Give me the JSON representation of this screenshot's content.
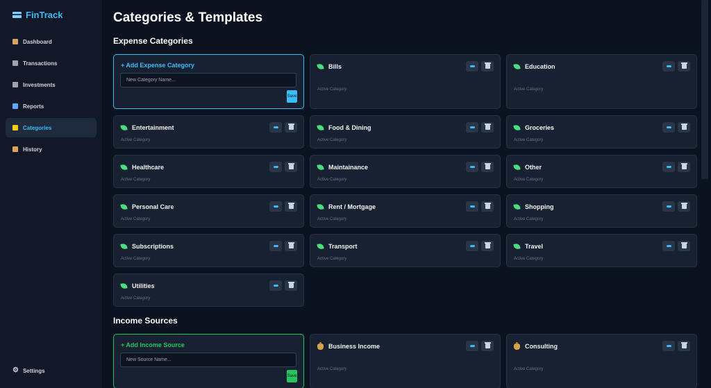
{
  "app": {
    "name": "FinTrack"
  },
  "nav": {
    "items": [
      {
        "label": "Dashboard",
        "icon": "house-icon",
        "color": "#d6a36a"
      },
      {
        "label": "Transactions",
        "icon": "table-icon",
        "color": "#9ca3af"
      },
      {
        "label": "Investments",
        "icon": "chart-line-icon",
        "color": "#9ca3af"
      },
      {
        "label": "Reports",
        "icon": "bar-chart-icon",
        "color": "#60a5fa"
      },
      {
        "label": "Categories",
        "icon": "tag-icon",
        "color": "#facc15",
        "active": true
      },
      {
        "label": "History",
        "icon": "scroll-icon",
        "color": "#e0a458"
      }
    ],
    "settings_label": "Settings"
  },
  "page": {
    "title": "Categories & Templates"
  },
  "expense": {
    "title": "Expense Categories",
    "add_label": "+ Add Expense Category",
    "input_placeholder": "New Category Name...",
    "save_label": "Save",
    "accent": "#38bdf8",
    "categories": [
      {
        "name": "Bills",
        "status": "Active Category"
      },
      {
        "name": "Education",
        "status": "Active Category"
      },
      {
        "name": "Entertainment",
        "status": "Active Category"
      },
      {
        "name": "Food & Dining",
        "status": "Active Category"
      },
      {
        "name": "Groceries",
        "status": "Active Category"
      },
      {
        "name": "Healthcare",
        "status": "Active Category"
      },
      {
        "name": "Maintainance",
        "status": "Active Category"
      },
      {
        "name": "Other",
        "status": "Active Category"
      },
      {
        "name": "Personal Care",
        "status": "Active Category"
      },
      {
        "name": "Rent / Mortgage",
        "status": "Active Category"
      },
      {
        "name": "Shopping",
        "status": "Active Category"
      },
      {
        "name": "Subscriptions",
        "status": "Active Category"
      },
      {
        "name": "Transport",
        "status": "Active Category"
      },
      {
        "name": "Travel",
        "status": "Active Category"
      },
      {
        "name": "Utilities",
        "status": "Active Category"
      }
    ]
  },
  "income": {
    "title": "Income Sources",
    "add_label": "+ Add Income Source",
    "input_placeholder": "New Source Name...",
    "save_label": "Save",
    "accent": "#22c55e",
    "sources": [
      {
        "name": "Business Income",
        "status": "Active Category"
      },
      {
        "name": "Consulting",
        "status": "Active Category"
      }
    ]
  }
}
